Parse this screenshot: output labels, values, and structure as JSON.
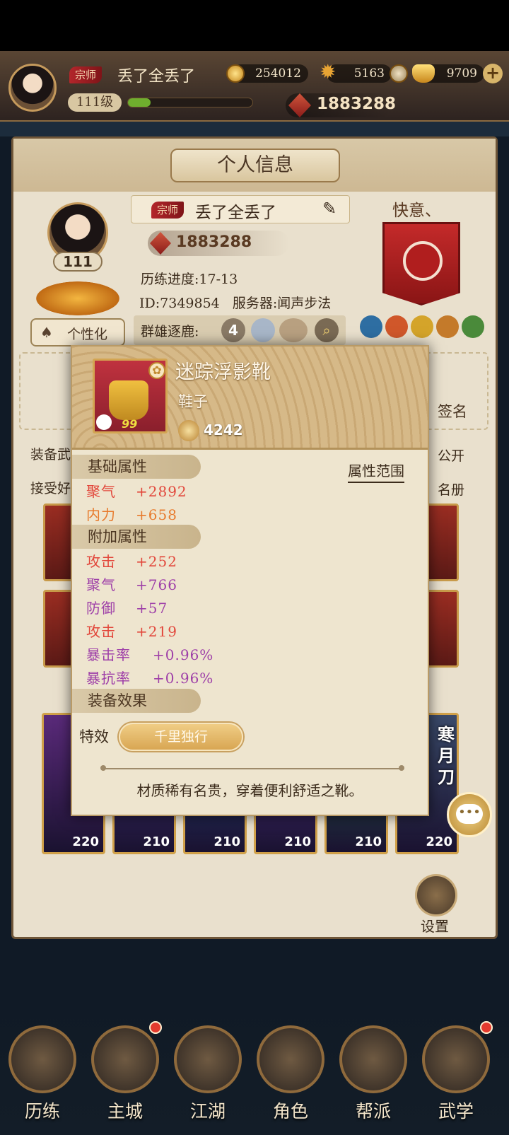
{
  "topbar": {
    "rank": "宗师",
    "player_name": "丢了全丢了",
    "level": "111级",
    "level_progress": 0.18,
    "copper": "254012",
    "ingot": "5163",
    "gold": "9709",
    "power": "1883288"
  },
  "panel": {
    "title": "个人信息",
    "rank": "宗师",
    "player_name": "丢了全丢了",
    "power": "1883288",
    "avatar_level": "111",
    "progress": "历练进度:17-13",
    "id_server": "ID:7349854   服务器:闻声步法",
    "arena_label": "群雄逐鹿:",
    "arena_num": "4",
    "customize": "个性化",
    "guild_name": "快意、",
    "signature_label": "签名",
    "left_text_1": "装备武",
    "left_text_2": "接受好",
    "right_text_1": "公开",
    "right_text_2": "名册",
    "hero_levels": [
      "220",
      "210",
      "210",
      "210",
      "210",
      "220"
    ],
    "hero_side_text": "寒月刀",
    "settings": "设置"
  },
  "item": {
    "name": "迷踪浮影靴",
    "type": "鞋子",
    "score": "4242",
    "icon_level": "99",
    "base_section": "基础属性",
    "range_link": "属性范围",
    "base_stats": [
      {
        "name": "聚气",
        "value": "+2892"
      },
      {
        "name": "内力",
        "value": "+658"
      }
    ],
    "extra_section": "附加属性",
    "extra_stats": [
      {
        "name": "攻击",
        "value": "+252",
        "color": "#e2463a"
      },
      {
        "name": "聚气",
        "value": "+766",
        "color": "#9e3fa8"
      },
      {
        "name": "防御",
        "value": "+57",
        "color": "#9e3fa8"
      },
      {
        "name": "攻击",
        "value": "+219",
        "color": "#e2463a"
      },
      {
        "name": "暴击率",
        "value": "+0.96%",
        "color": "#9e3fa8"
      },
      {
        "name": "暴抗率",
        "value": "+0.96%",
        "color": "#9e3fa8"
      }
    ],
    "effect_section": "装备效果",
    "effect_label": "特效",
    "effect_name": "千里独行",
    "description": "材质稀有名贵，穿着便利舒适之靴。"
  },
  "nav": {
    "items": [
      "历练",
      "主城",
      "江湖",
      "角色",
      "帮派",
      "武学"
    ]
  }
}
